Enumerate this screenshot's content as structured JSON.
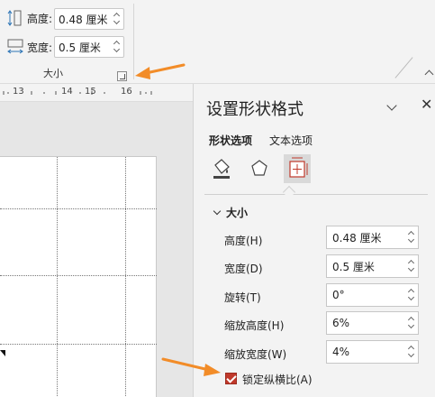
{
  "ribbon": {
    "height_label": "高度:",
    "height_value": "0.48 厘米",
    "width_label": "宽度:",
    "width_value": "0.5 厘米",
    "group_label": "大小"
  },
  "ruler": {
    "ticks": [
      "13",
      "14",
      "15",
      "16"
    ]
  },
  "pane": {
    "title": "设置形状格式",
    "tabs": [
      {
        "label": "形状选项",
        "active": true
      },
      {
        "label": "文本选项",
        "active": false
      }
    ],
    "icons": [
      "fill-line-icon",
      "effects-icon",
      "size-properties-icon"
    ],
    "section_title": "大小",
    "fields": [
      {
        "label": "高度(H)",
        "value": "0.48 厘米"
      },
      {
        "label": "宽度(D)",
        "value": "0.5 厘米"
      },
      {
        "label": "旋转(T)",
        "value": "0°"
      },
      {
        "label": "缩放高度(H)",
        "value": "6%"
      },
      {
        "label": "缩放宽度(W)",
        "value": "4%"
      }
    ],
    "lock_aspect_label": "锁定纵横比(A)",
    "lock_aspect_checked": true
  },
  "colors": {
    "accent_arrow": "#f28c28",
    "checkbox": "#c0392b"
  }
}
